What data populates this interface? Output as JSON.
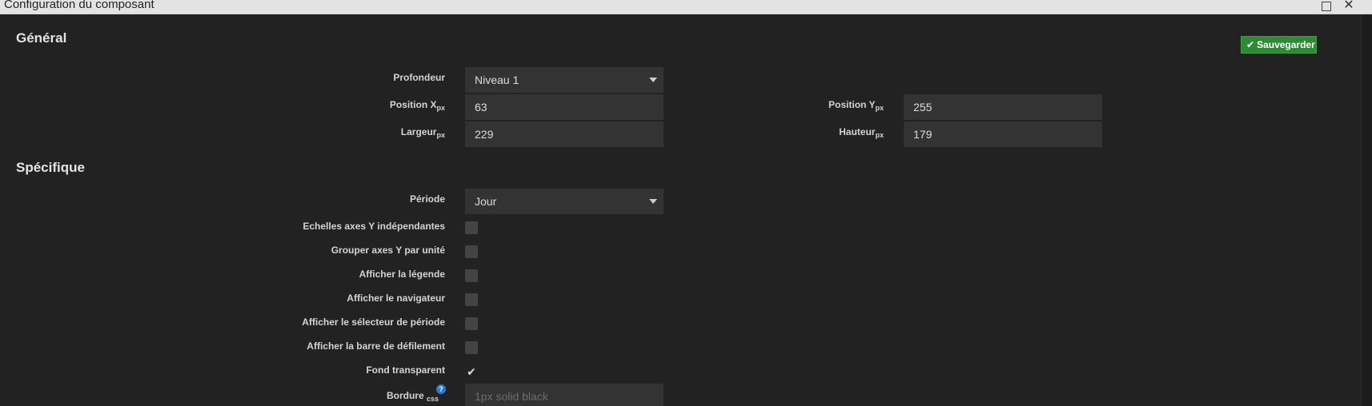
{
  "window": {
    "title": "Configuration du composant"
  },
  "general": {
    "title": "Général",
    "save_label": "Sauvegarder",
    "depth": {
      "label": "Profondeur",
      "value": "Niveau 1"
    },
    "position_x": {
      "label": "Position X",
      "unit": "px",
      "value": "63"
    },
    "position_y": {
      "label": "Position Y",
      "unit": "px",
      "value": "255"
    },
    "width": {
      "label": "Largeur",
      "unit": "px",
      "value": "229"
    },
    "height": {
      "label": "Hauteur",
      "unit": "px",
      "value": "179"
    }
  },
  "specific": {
    "title": "Spécifique",
    "period": {
      "label": "Période",
      "value": "Jour"
    },
    "options": [
      {
        "label": "Echelles axes Y indépendantes",
        "checked": false
      },
      {
        "label": "Grouper axes Y par unité",
        "checked": false
      },
      {
        "label": "Afficher la légende",
        "checked": false
      },
      {
        "label": "Afficher le navigateur",
        "checked": false
      },
      {
        "label": "Afficher le sélecteur de période",
        "checked": false
      },
      {
        "label": "Afficher la barre de défilement",
        "checked": false
      },
      {
        "label": "Fond transparent",
        "checked": true
      }
    ],
    "border": {
      "label": "Bordure",
      "unit": "css",
      "placeholder": "1px solid black"
    }
  }
}
